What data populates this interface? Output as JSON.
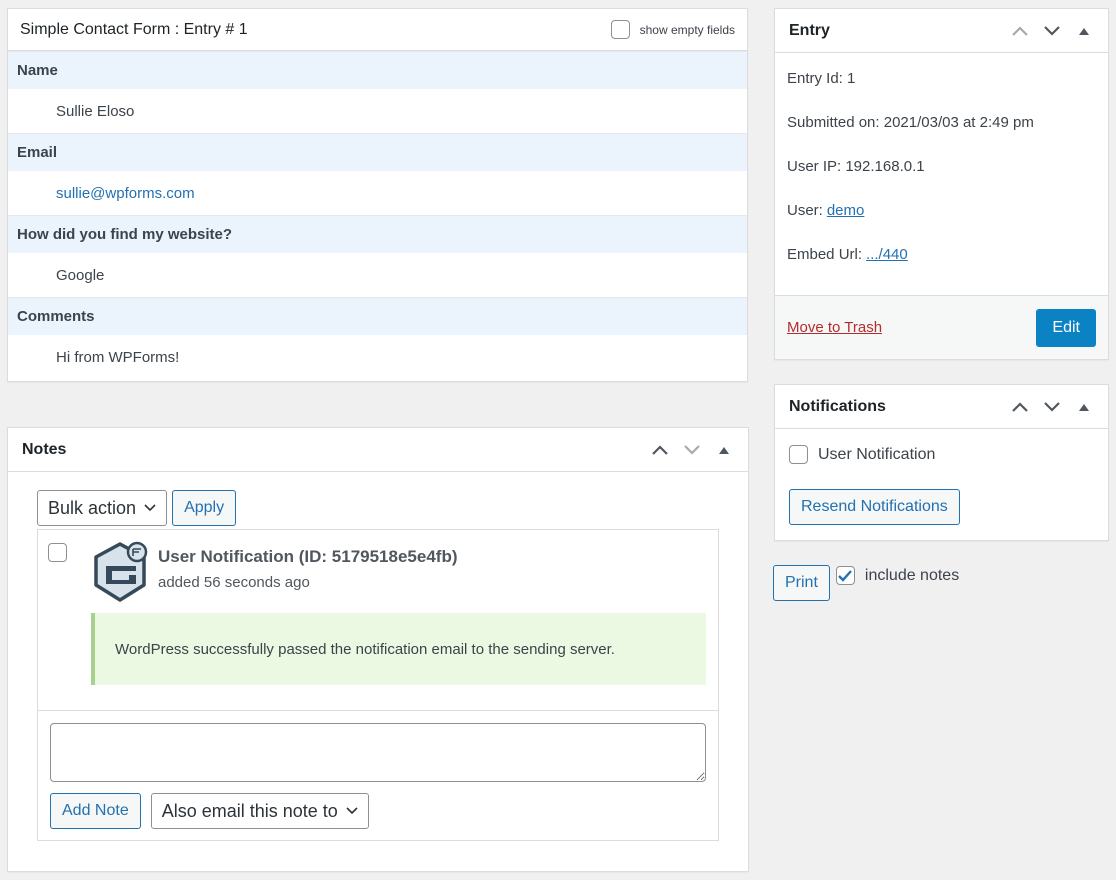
{
  "entry_detail": {
    "title": "Simple Contact Form : Entry # 1",
    "show_empty_label": "show empty fields",
    "show_empty_checked": false,
    "fields": [
      {
        "label": "Name",
        "value": "Sullie Eloso",
        "is_link": false
      },
      {
        "label": "Email",
        "value": "sullie@wpforms.com",
        "is_link": true
      },
      {
        "label": "How did you find my website?",
        "value": "Google",
        "is_link": false
      },
      {
        "label": "Comments",
        "value": "Hi from WPForms!",
        "is_link": false
      }
    ]
  },
  "notes": {
    "title": "Notes",
    "bulk_action": "Bulk action",
    "apply_label": "Apply",
    "items": [
      {
        "title": "User Notification (ID: 5179518e5e4fb)",
        "time": "added 56 seconds ago",
        "message": "WordPress successfully passed the notification email to the sending server.",
        "avatar_icon": "gravity-forms-logo-icon"
      }
    ],
    "textarea_value": "",
    "add_note_label": "Add Note",
    "email_select": "Also email this note to"
  },
  "entry_box": {
    "title": "Entry",
    "entry_id_label": "Entry Id: 1",
    "submitted_label": "Submitted on: 2021/03/03 at 2:49 pm",
    "user_ip_label": "User IP: 192.168.0.1",
    "user_label": "User:",
    "user_link": "demo",
    "embed_label": "Embed Url:",
    "embed_link": ".../440",
    "trash_label": "Move to Trash",
    "edit_label": "Edit"
  },
  "notifications": {
    "title": "Notifications",
    "option_label": "User Notification",
    "option_checked": false,
    "resend_label": "Resend Notifications"
  },
  "print": {
    "print_label": "Print",
    "include_notes_label": "include notes",
    "include_notes_checked": true
  },
  "colors": {
    "accent": "#2271b1",
    "primary_button": "#0a82c4",
    "trash": "#b32d2e",
    "field_label_bg": "#ebf3fc",
    "note_success_bg": "#ebf9e3"
  }
}
